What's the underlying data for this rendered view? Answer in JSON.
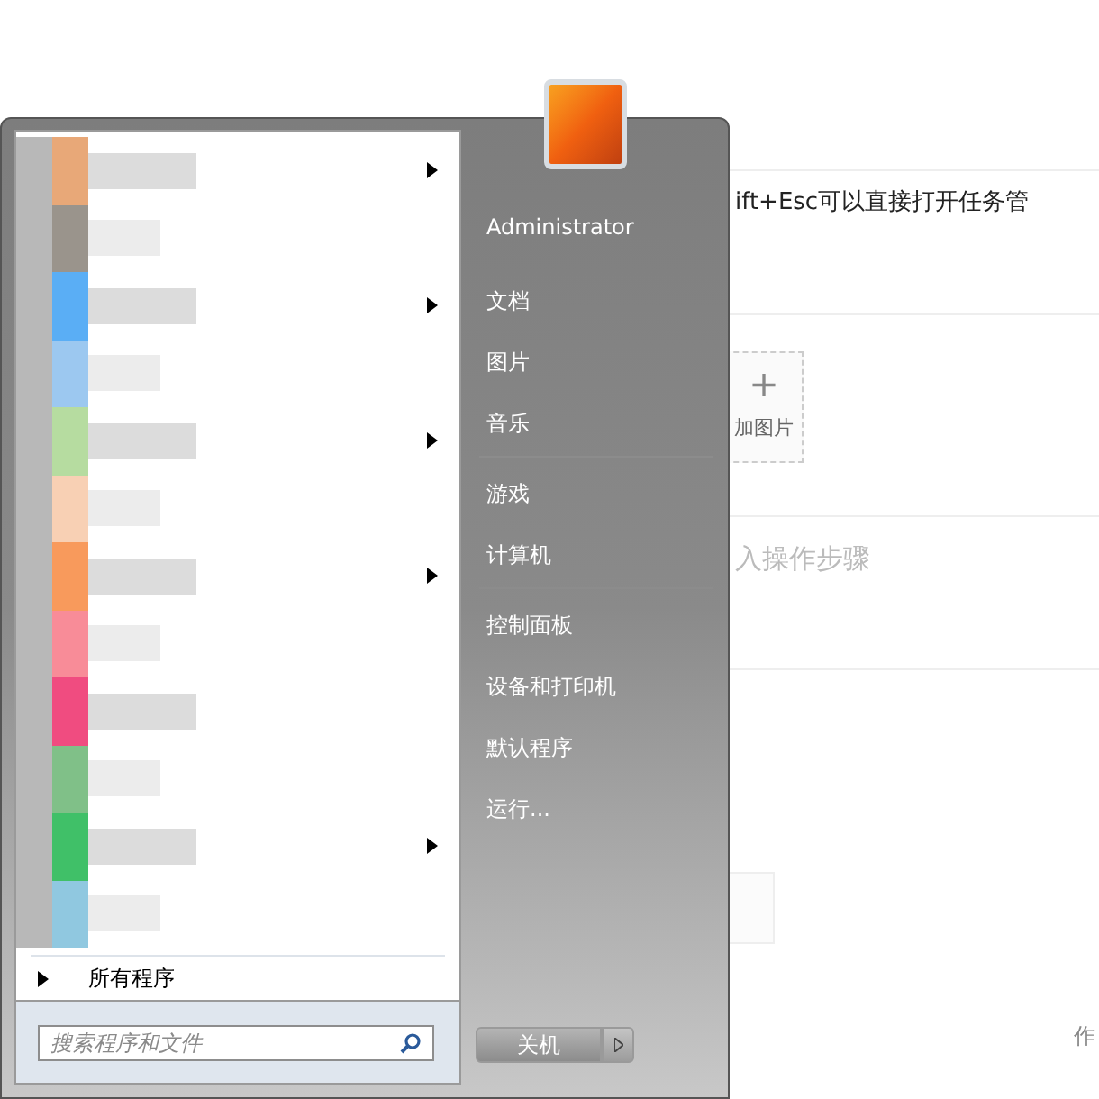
{
  "background_page": {
    "step_text": "ift+Esc可以直接打开任务管",
    "add_image": {
      "icon": "+",
      "label": "加图片"
    },
    "step_placeholder": "入操作步骤",
    "footer_text": "作"
  },
  "start_menu": {
    "programs": [
      {
        "submenu": true
      },
      {
        "submenu": false
      },
      {
        "submenu": true
      },
      {
        "submenu": false
      },
      {
        "submenu": true
      },
      {
        "submenu": false
      },
      {
        "submenu": true
      },
      {
        "submenu": false
      },
      {
        "submenu": false
      },
      {
        "submenu": false
      },
      {
        "submenu": true
      },
      {
        "submenu": false
      }
    ],
    "all_programs": "所有程序",
    "search": {
      "placeholder": "搜索程序和文件"
    },
    "user_name": "Administrator",
    "places": [
      [
        "文档",
        "图片",
        "音乐"
      ],
      [
        "游戏",
        "计算机"
      ],
      [
        "控制面板",
        "设备和打印机",
        "默认程序",
        "运行..."
      ]
    ],
    "shutdown": "关机"
  }
}
